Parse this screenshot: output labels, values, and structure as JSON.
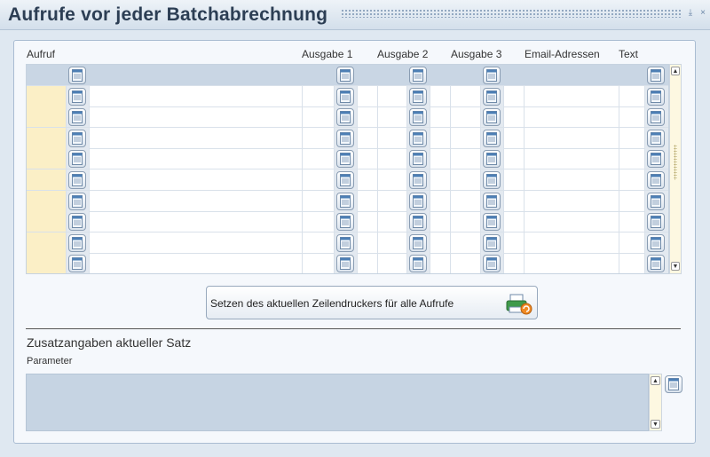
{
  "window": {
    "title": "Aufrufe vor jeder Batchabrechnung"
  },
  "columns": {
    "aufruf": "Aufruf",
    "ausgabe1": "Ausgabe 1",
    "ausgabe2": "Ausgabe 2",
    "ausgabe3": "Ausgabe 3",
    "email": "Email-Adressen",
    "text": "Text"
  },
  "grid": {
    "empty_rows": 9
  },
  "actions": {
    "set_printer_label": "Setzen des aktuellen Zeilendruckers für alle Aufrufe"
  },
  "details": {
    "section_title": "Zusatzangaben aktueller Satz",
    "parameter_label": "Parameter"
  },
  "icons": {
    "cell_button": "document-icon",
    "printer": "printer-refresh-icon"
  },
  "colors": {
    "key_cell": "#fbefc6",
    "header_row": "#c9d6e4",
    "param_area": "#c6d4e3",
    "title": "#2c3e54"
  }
}
